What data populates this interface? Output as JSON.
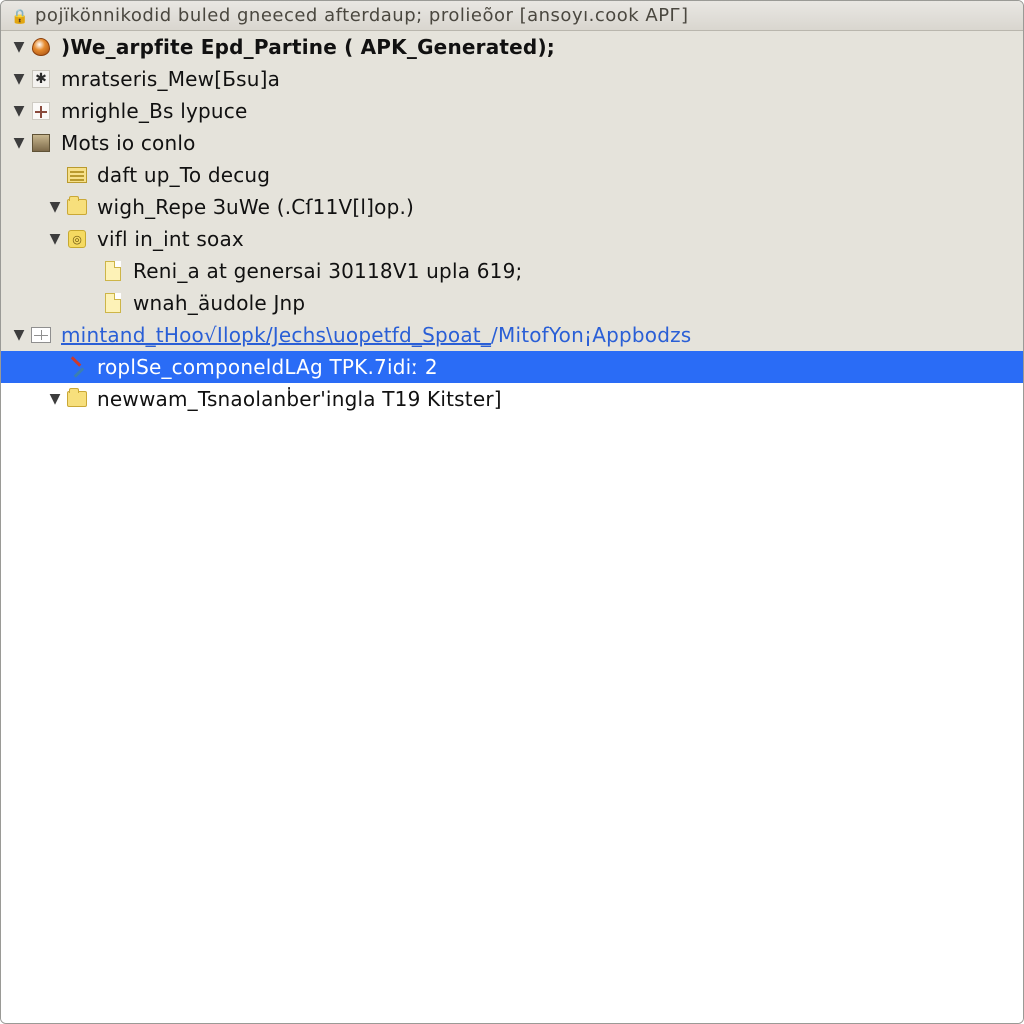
{
  "window": {
    "title": "pojïkönnikodid  buled  gneeced afterdaup;  prolieõor  [ansoyı.cook  APГ]"
  },
  "tree": {
    "rows": [
      {
        "indent": 0,
        "twisty": "▼",
        "icon": "shield-icon",
        "label": ")We_arpfite Epd_Partine ( APK_Generated);",
        "bold": true,
        "band": true,
        "interactable": true
      },
      {
        "indent": 0,
        "twisty": "▼",
        "icon": "spider-icon",
        "label": "mratseris_Mew[Бsu]a",
        "band": true,
        "interactable": true
      },
      {
        "indent": 0,
        "twisty": "▼",
        "icon": "cross-icon",
        "label": "mrighle_Bs lypuce",
        "band": true,
        "interactable": true
      },
      {
        "indent": 0,
        "twisty": "▼",
        "icon": "photo-icon",
        "label": "Mots io conlo",
        "band": true,
        "interactable": true
      },
      {
        "indent": 1,
        "twisty": "",
        "icon": "board-icon",
        "label": "daft up_To decug",
        "band": true,
        "interactable": true
      },
      {
        "indent": 1,
        "twisty": "▼",
        "icon": "folder-icon",
        "label": "wigh_Repe ЗuWe (.Cſ11V[l]op.)",
        "band": true,
        "interactable": true
      },
      {
        "indent": 1,
        "twisty": "▼",
        "icon": "package-icon",
        "label": "vifl in_int soax",
        "band": true,
        "interactable": true
      },
      {
        "indent": 2,
        "twisty": "",
        "icon": "file-icon",
        "label": "Reni_a at genersai 30118V1 upla 619;",
        "band": true,
        "interactable": true
      },
      {
        "indent": 2,
        "twisty": "",
        "icon": "file-icon",
        "label": "wnah_äudole Jnp",
        "band": true,
        "interactable": true
      },
      {
        "indent": 0,
        "twisty": "▼",
        "icon": "grid-icon",
        "label_html": "<span class='u'>mintand_tHoo√Ilopk/Jechs\\uopetfd_Spoat_</span>/MitofYon¡Appbodzs",
        "link": true,
        "band": true,
        "interactable": true
      },
      {
        "indent": 1,
        "twisty": "",
        "icon": "tools-icon",
        "label_html": "roplSe_<span class='u'>c</span>omponeldLAg  TPK.7idiː 2",
        "selected": true,
        "interactable": true
      },
      {
        "indent": 1,
        "twisty": "▼",
        "icon": "folder-icon",
        "label": "newwam_Tsnaolanḃer'ingla T19 Kitster]",
        "interactable": true
      }
    ]
  }
}
